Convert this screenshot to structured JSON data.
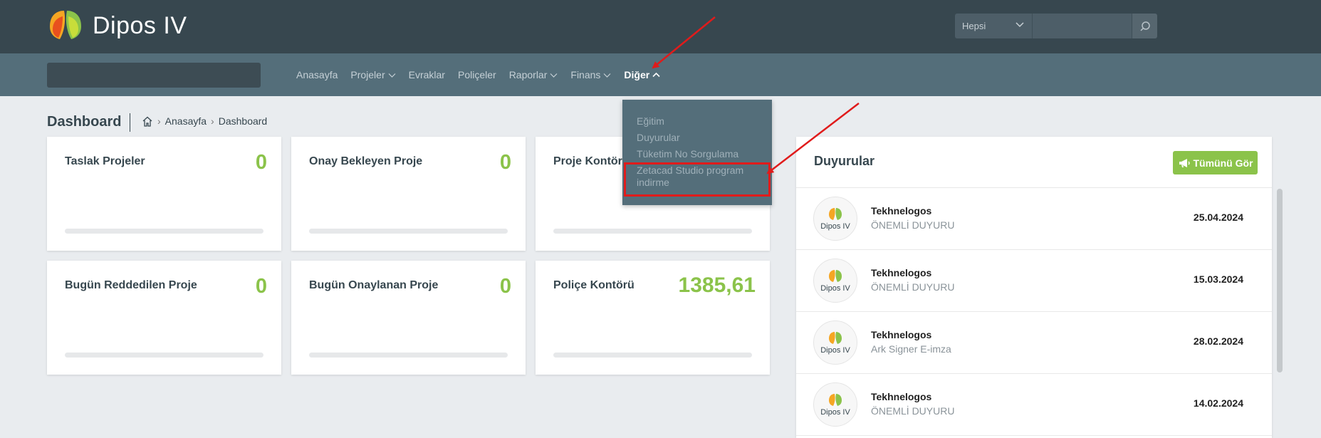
{
  "app": {
    "name": "Dipos IV"
  },
  "header": {
    "search_scope": "Hepsi",
    "search_value": ""
  },
  "nav": {
    "search_value": "",
    "items": [
      {
        "label": "Anasayfa",
        "has_dropdown": false
      },
      {
        "label": "Projeler",
        "has_dropdown": true
      },
      {
        "label": "Evraklar",
        "has_dropdown": false
      },
      {
        "label": "Poliçeler",
        "has_dropdown": false
      },
      {
        "label": "Raporlar",
        "has_dropdown": true
      },
      {
        "label": "Finans",
        "has_dropdown": true
      },
      {
        "label": "Diğer",
        "has_dropdown": true,
        "active": true
      }
    ]
  },
  "dropdown": {
    "items": [
      "Eğitim",
      "Duyurular",
      "Tüketim No Sorgulama",
      "Zetacad Studio program",
      "indirme"
    ]
  },
  "page": {
    "title": "Dashboard"
  },
  "breadcrumb": {
    "home": "Anasayfa",
    "current": "Dashboard"
  },
  "cards": [
    {
      "title": "Taslak Projeler",
      "value": "0"
    },
    {
      "title": "Onay Bekleyen Proje",
      "value": "0"
    },
    {
      "title": "Proje Kontörü",
      "value": ""
    },
    {
      "title": "Bugün Reddedilen Proje",
      "value": "0"
    },
    {
      "title": "Bugün Onaylanan Proje",
      "value": "0"
    },
    {
      "title": "Poliçe Kontörü",
      "value": "1385,61"
    }
  ],
  "announcements": {
    "title": "Duyurular",
    "see_all": "Tümünü Gör",
    "avatar_text": "Dipos IV",
    "items": [
      {
        "name": "Tekhnelogos",
        "subtitle": "ÖNEMLİ DUYURU",
        "date": "25.04.2024"
      },
      {
        "name": "Tekhnelogos",
        "subtitle": "ÖNEMLİ DUYURU",
        "date": "15.03.2024"
      },
      {
        "name": "Tekhnelogos",
        "subtitle": "Ark Signer E-imza",
        "date": "28.02.2024"
      },
      {
        "name": "Tekhnelogos",
        "subtitle": "ÖNEMLİ DUYURU",
        "date": "14.02.2024"
      }
    ]
  },
  "colors": {
    "header_bg": "#37474f",
    "nav_bg": "#546e7a",
    "accent_green": "#8bc34a",
    "annotation_red": "#e01b1b"
  }
}
